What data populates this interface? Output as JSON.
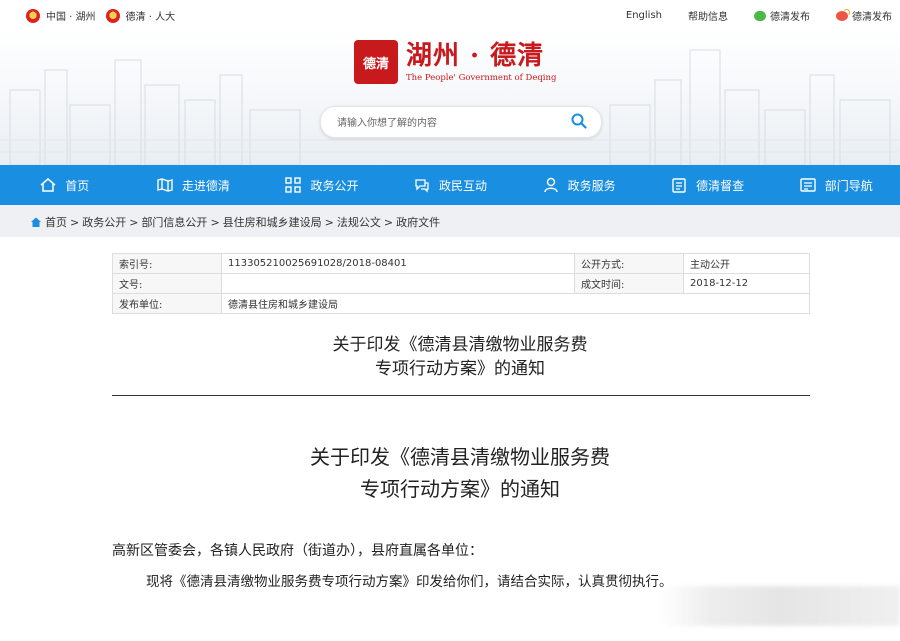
{
  "topbar": {
    "left_links": [
      "中国 · 湖州",
      "德清 · 人大"
    ],
    "right_links": [
      "English",
      "帮助信息",
      "德清发布",
      "德清发布"
    ]
  },
  "header": {
    "seal_text": "德清",
    "title": "湖州 · 德清",
    "subtitle": "The People' Government of Deqing"
  },
  "search": {
    "placeholder": "请输入你想了解的内容"
  },
  "nav": {
    "items": [
      {
        "label": "首页",
        "icon": "home-icon"
      },
      {
        "label": "走进德清",
        "icon": "map-icon"
      },
      {
        "label": "政务公开",
        "icon": "grid-icon"
      },
      {
        "label": "政民互动",
        "icon": "chat-icon"
      },
      {
        "label": "政务服务",
        "icon": "user-icon"
      },
      {
        "label": "德清督查",
        "icon": "clipboard-icon"
      },
      {
        "label": "部门导航",
        "icon": "list-icon"
      }
    ]
  },
  "breadcrumb": [
    "首页",
    "政务公开",
    "部门信息公开",
    "县住房和城乡建设局",
    "法规公文",
    "政府文件"
  ],
  "info": {
    "index_label": "索引号:",
    "index_value": "113305210025691028/2018-08401",
    "method_label": "公开方式:",
    "method_value": "主动公开",
    "docno_label": "文号:",
    "docno_value": "",
    "date_label": "成文时间:",
    "date_value": "2018-12-12",
    "publisher_label": "发布单位:",
    "publisher_value": "德清县住房和城乡建设局"
  },
  "doc": {
    "title_line1": "关于印发《德清县清缴物业服务费",
    "title_line2": "专项行动方案》的通知",
    "greeting": "高新区管委会，各镇人民政府（街道办），县府直属各单位：",
    "paragraph": "现将《德清县清缴物业服务费专项行动方案》印发给你们，请结合实际，认真贯彻执行。"
  },
  "colors": {
    "nav": "#1a8ee0",
    "brand_red": "#c8191d"
  }
}
